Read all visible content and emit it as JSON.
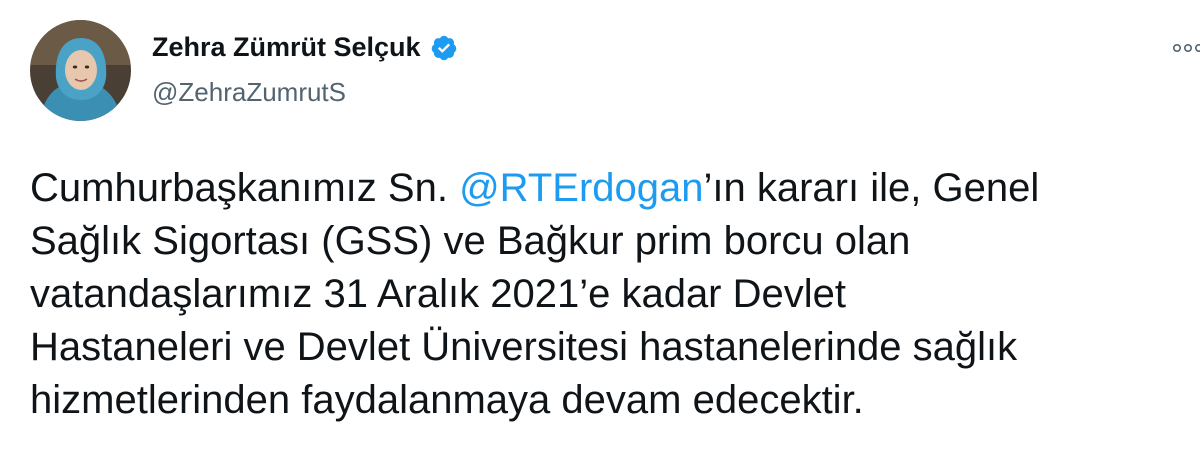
{
  "user": {
    "display_name": "Zehra Zümrüt Selçuk",
    "handle": "@ZehraZumrutS",
    "verified": true,
    "avatar_icon": "profile-photo"
  },
  "tweet": {
    "line1_before": "Cumhurbaşkanımız Sn. ",
    "mention": "@RTErdogan",
    "line1_after": "’ın kararı ile, Genel",
    "line2": "Sağlık Sigortası (GSS) ve Bağkur prim borcu olan",
    "line3": "vatandaşlarımız 31 Aralık 2021’e kadar Devlet",
    "line4": "Hastaneleri ve Devlet Üniversitesi hastanelerinde sağlık",
    "line5": "hizmetlerinden faydalanmaya devam edecektir."
  },
  "icons": {
    "verified": "verified-badge-icon",
    "more": "more-options-icon"
  },
  "colors": {
    "text": "#0f1419",
    "secondary": "#536471",
    "accent": "#1d9bf0"
  }
}
